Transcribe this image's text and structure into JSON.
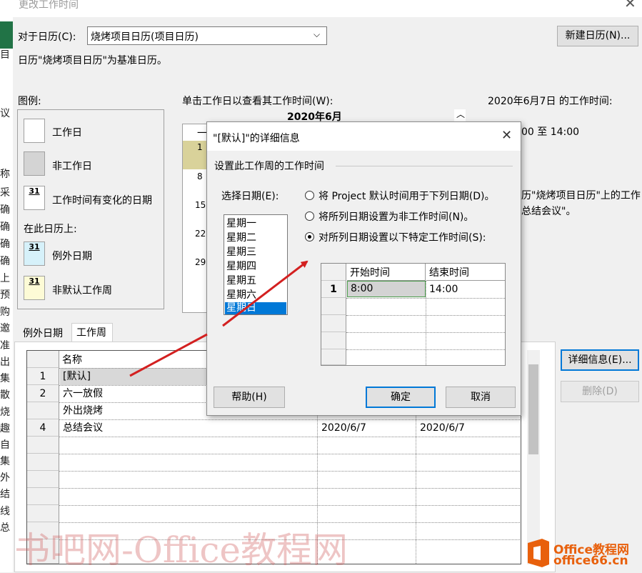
{
  "window": {
    "title": "更改工作时间"
  },
  "bg_strip": {
    "chars": [
      "目",
      "议",
      "称",
      "采",
      "确",
      "确",
      "确",
      "确",
      "上",
      "预",
      "购",
      "邀",
      "准",
      "出",
      "集",
      "散",
      "烧",
      "趣",
      "自",
      "集",
      "外",
      "结",
      "线",
      "总"
    ]
  },
  "calendar_row": {
    "label": "对于日历(C):",
    "value": "烧烤项目日历(项目日历)",
    "new_button": "新建日历(N)..."
  },
  "base_note": "日历\"烧烤项目日历\"为基准日历。",
  "legend": {
    "title": "图例:",
    "items": [
      {
        "label": "工作日"
      },
      {
        "label": "非工作日"
      },
      {
        "label": "工作时间有变化的日期",
        "num": "31"
      }
    ],
    "on_calendar": "在此日历上:",
    "items2": [
      {
        "label": "例外日期",
        "num": "31"
      },
      {
        "label": "非默认工作周",
        "num": "31"
      }
    ]
  },
  "calendar_view": {
    "hint": "单击工作日以查看其工作时间(W):",
    "month": "2020年6月",
    "header": "一",
    "dates": [
      "1",
      "8",
      "15",
      "22",
      "29"
    ]
  },
  "work_times": {
    "title": "2020年6月7日 的工作时间:",
    "range_fragment": "00 至 14:00",
    "note_line1": "历\"烧烤项目日历\"上的工作",
    "note_line2": "总结会议\"。"
  },
  "tabs": [
    {
      "label": "例外日期"
    },
    {
      "label": "工作周"
    }
  ],
  "weeks_table": {
    "header_name": "名称",
    "rows": [
      {
        "num": "1",
        "name": "[默认]",
        "start": "",
        "end": ""
      },
      {
        "num": "2",
        "name": "六一放假",
        "start": "",
        "end": ""
      },
      {
        "num": "",
        "name": "外出烧烤",
        "start": "",
        "end": ""
      },
      {
        "num": "4",
        "name": "总结会议",
        "start": "2020/6/7",
        "end": "2020/6/7"
      }
    ]
  },
  "side_buttons": {
    "details": "详细信息(E)...",
    "delete": "删除(D)"
  },
  "details_dialog": {
    "title": "\"[默认]\"的详细信息",
    "section": "设置此工作周的工作时间",
    "select_days_label": "选择日期(E):",
    "days": [
      "星期一",
      "星期二",
      "星期三",
      "星期四",
      "星期五",
      "星期六",
      "星期日"
    ],
    "selected_day": "星期日",
    "options": [
      {
        "label": "将 Project 默认时间用于下列日期(D)。",
        "checked": false
      },
      {
        "label": "将所列日期设置为非工作时间(N)。",
        "checked": false
      },
      {
        "label": "对所列日期设置以下特定工作时间(S):",
        "checked": true
      }
    ],
    "time_table": {
      "col_start": "开始时间",
      "col_end": "结束时间",
      "rows": [
        {
          "num": "1",
          "start": "8:00",
          "end": "14:00"
        }
      ]
    },
    "help_button": "帮助(H)",
    "ok_button": "确定",
    "cancel_button": "取消"
  },
  "watermark": "书吧网-Office教程网",
  "logo": {
    "line1": "Office教程网",
    "line2": "office66.cn"
  },
  "colors": {
    "accent": "#0078d7",
    "arrow": "#d32020",
    "excel_green": "#217346"
  }
}
